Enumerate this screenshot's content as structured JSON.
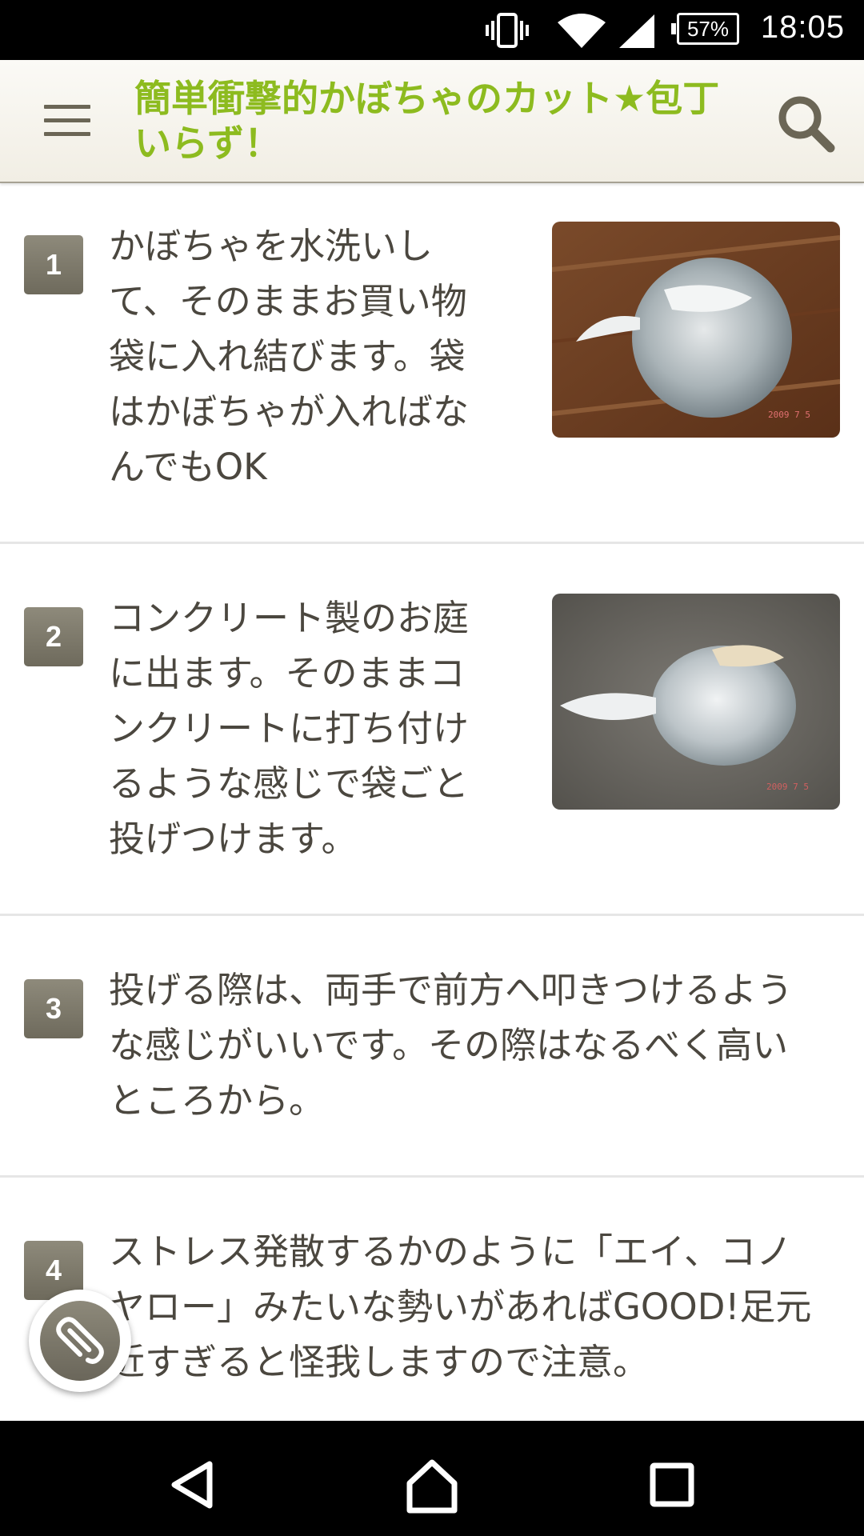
{
  "status_bar": {
    "time": "18:05",
    "battery": "57%",
    "icons": [
      "vibrate-icon",
      "wifi-icon",
      "signal-icon",
      "battery-icon"
    ]
  },
  "app_bar": {
    "title": "簡単衝撃的かぼちゃのカット★包丁いらず！",
    "title_line1": "簡単衝撃的かぼちゃのカット★包丁",
    "title_line2": "いらず！",
    "title_color": "#8dbb1f",
    "menu_icon": "menu-icon",
    "search_icon": "search-icon"
  },
  "steps": [
    {
      "number": "1",
      "lines": [
        "かぼちゃを水洗いし",
        "て、そのままお買い物",
        "袋に入れ結びます。袋",
        "はかぼちゃが入ればな",
        "んでもOK"
      ],
      "has_image": true
    },
    {
      "number": "2",
      "lines": [
        "コンクリート製のお庭",
        "に出ます。そのままコ",
        "ンクリートに打ち付け",
        "るような感じで袋ごと",
        "投げつけます。"
      ],
      "has_image": true
    },
    {
      "number": "3",
      "lines": [
        "投げる際は、両手で前方へ叩きつけるよう",
        "な感じがいいです。その際はなるべく高い",
        "ところから。"
      ],
      "has_image": false
    },
    {
      "number": "4",
      "lines": [
        "ストレス発散するかのように「エイ、コノ",
        "ヤロー」みたいな勢いがあればGOOD!足元",
        "近すぎると怪我しますので注意。"
      ],
      "has_image": false
    }
  ],
  "fab": {
    "icon": "paperclip-icon"
  },
  "nav_bar": {
    "icons": [
      "back-icon",
      "home-icon",
      "recents-icon"
    ]
  },
  "colors": {
    "accent": "#8dbb1f",
    "badge": "#7d796b",
    "text": "#4b473f"
  }
}
